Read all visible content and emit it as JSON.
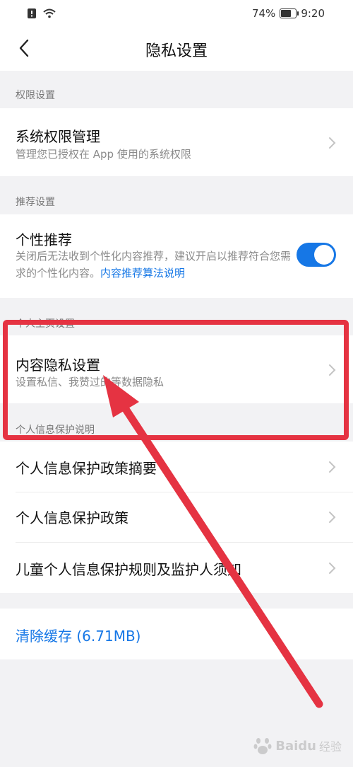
{
  "status_bar": {
    "battery_percent": "74%",
    "battery_level": 0.74,
    "time": "9:20"
  },
  "nav": {
    "title": "隐私设置",
    "back_icon": "chevron-left-icon"
  },
  "sections": {
    "permissions": {
      "header": "权限设置",
      "item_title": "系统权限管理",
      "item_sub": "管理您已授权在 App 使用的系统权限"
    },
    "recommend": {
      "header": "推荐设置",
      "item_title": "个性推荐",
      "item_desc": "关闭后无法收到个性化内容推荐，建议开启以推荐符合您需求的个性化内容。",
      "item_link": "内容推荐算法说明",
      "toggle_on": true
    },
    "personal": {
      "header": "个人主页设置",
      "item_title": "内容隐私设置",
      "item_sub": "设置私信、我赞过的等数据隐私"
    },
    "protection": {
      "header": "个人信息保护说明",
      "items": [
        "个人信息保护政策摘要",
        "个人信息保护政策",
        "儿童个人信息保护规则及监护人须知"
      ]
    }
  },
  "clear_cache": "清除缓存 (6.71MB)",
  "watermark": {
    "brand": "Baidu",
    "sub": "经验"
  },
  "colors": {
    "accent": "#1677e6",
    "annotation": "#e53342",
    "background": "#f2f2f4"
  }
}
